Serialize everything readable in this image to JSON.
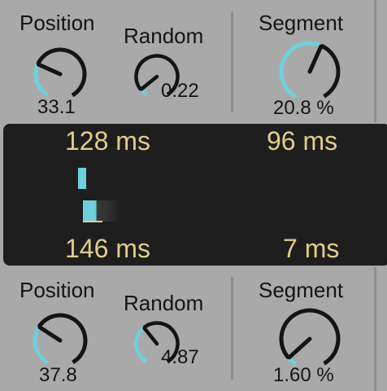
{
  "top": {
    "position": {
      "label": "Position",
      "value": "33.1",
      "fraction": 0.28
    },
    "random": {
      "label": "Random",
      "value": "0.22",
      "fraction": 0.07
    },
    "segment": {
      "label": "Segment",
      "value": "20.8 %",
      "fraction": 0.58
    }
  },
  "display": {
    "time_top_left": "128 ms",
    "time_top_right": "96 ms",
    "time_bottom_left": "146 ms",
    "time_bottom_right": "7 ms"
  },
  "bottom": {
    "position": {
      "label": "Position",
      "value": "37.8",
      "fraction": 0.31
    },
    "random": {
      "label": "Random",
      "value": "4.87",
      "fraction": 0.37
    },
    "segment": {
      "label": "Segment",
      "value": "1.60 %",
      "fraction": 0.06
    }
  },
  "colors": {
    "background": "#a9a9a9",
    "display_bg": "#1e1e1e",
    "accent": "#6dd0dc",
    "time_text": "#e2cd8a",
    "knob_dark": "#141414"
  }
}
